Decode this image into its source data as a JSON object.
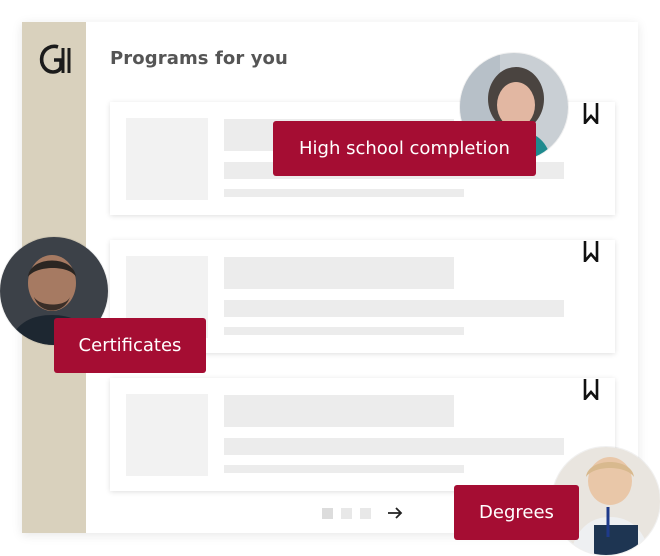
{
  "colors": {
    "rail": "#d9d1bd",
    "accent": "#a50d33",
    "heading": "#555555"
  },
  "header": {
    "title": "Programs for you",
    "logo_icon": "brand-monogram-icon"
  },
  "tags": [
    {
      "label": "High school completion"
    },
    {
      "label": "Certificates"
    },
    {
      "label": "Degrees"
    }
  ],
  "programs": [
    {
      "bookmark_icon": "bookmark-icon"
    },
    {
      "bookmark_icon": "bookmark-icon"
    },
    {
      "bookmark_icon": "bookmark-icon"
    }
  ],
  "pagination": {
    "pages": 3,
    "next_icon": "arrow-right-icon"
  }
}
